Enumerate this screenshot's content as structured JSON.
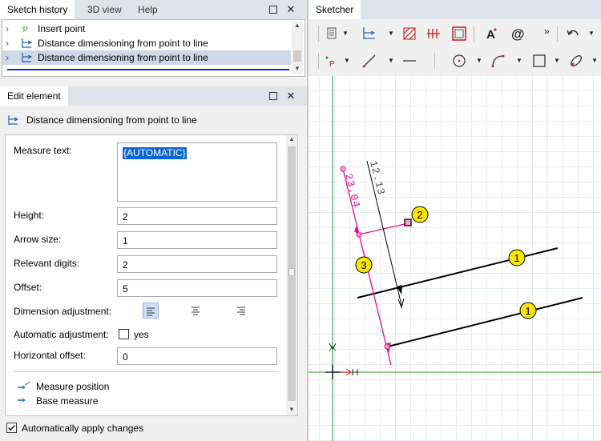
{
  "left_tabs": [
    {
      "label": "Sketch history"
    },
    {
      "label": "3D view"
    },
    {
      "label": "Help"
    }
  ],
  "history": {
    "items": [
      {
        "label": "Insert point",
        "icon": "insert-point-icon"
      },
      {
        "label": "Distance dimensioning from point to line",
        "icon": "dimension-icon"
      },
      {
        "label": "Distance dimensioning from point to line",
        "icon": "dimension-icon",
        "selected": true
      }
    ]
  },
  "edit": {
    "tab_label": "Edit element",
    "title": "Distance dimensioning from point to line",
    "measure_text_label": "Measure text:",
    "measure_text_value": "{AUTOMATIC}",
    "height_label": "Height:",
    "height_value": "2",
    "arrow_size_label": "Arrow size:",
    "arrow_size_value": "1",
    "relevant_digits_label": "Relevant digits:",
    "relevant_digits_value": "2",
    "offset_label": "Offset:",
    "offset_value": "5",
    "dimension_adjustment_label": "Dimension adjustment:",
    "automatic_adjustment_label": "Automatic adjustment:",
    "automatic_adjustment_option": "yes",
    "automatic_adjustment_checked": false,
    "horizontal_offset_label": "Horizontal offset:",
    "horizontal_offset_value": "0",
    "measure_position_label": "Measure position",
    "base_measure_label": "Base measure",
    "auto_apply_label": "Automatically apply changes",
    "auto_apply_checked": true
  },
  "sketcher": {
    "tab_label": "Sketcher",
    "dimension_text_black": "12.13",
    "dimension_text_magenta": "23.04",
    "callout_1": "1",
    "callout_2": "2",
    "callout_3": "3",
    "colors": {
      "grid": "#c8dcf0",
      "magenta": "#e0109a",
      "callout_fill": "#ffe600",
      "axis_green": "#2a9a2a",
      "axis_red": "#d21b1b"
    }
  }
}
